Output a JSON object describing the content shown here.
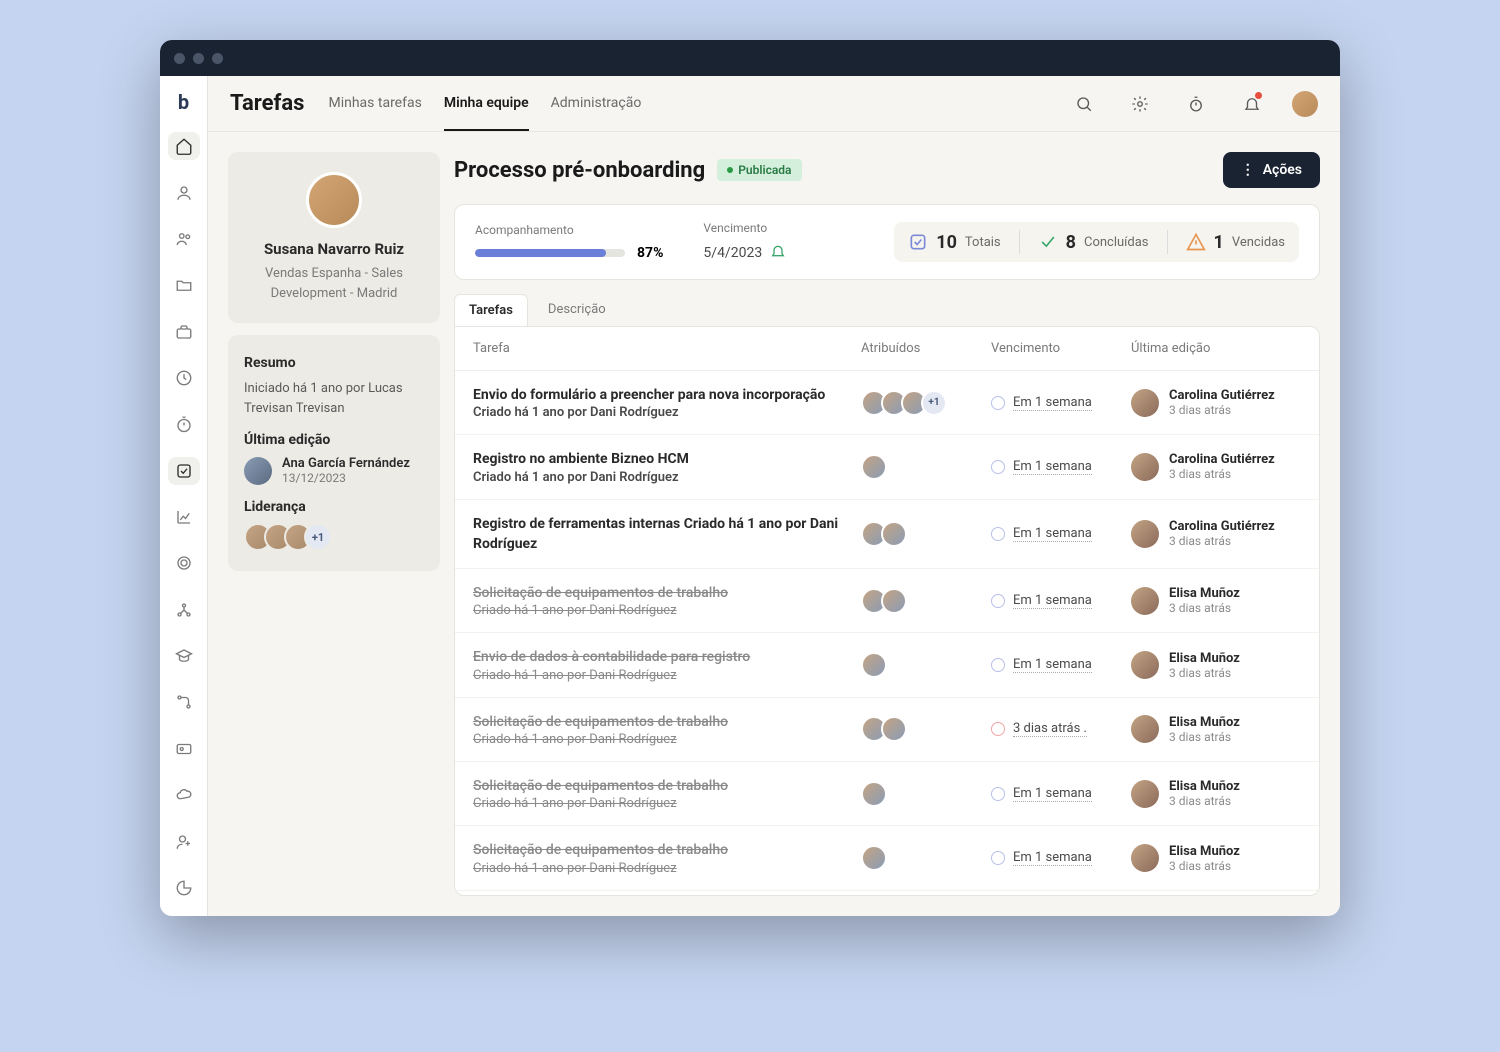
{
  "header": {
    "brand": "Tarefas",
    "tabs": [
      "Minhas tarefas",
      "Minha equipe",
      "Administração"
    ],
    "activeTab": 1
  },
  "profile": {
    "name": "Susana Navarro Ruiz",
    "subtitle": "Vendas Espanha - Sales Development - Madrid"
  },
  "summary": {
    "title": "Resumo",
    "started": "Iniciado há 1 ano por Lucas Trevisan Trevisan",
    "lastEditLabel": "Última edição",
    "editor": {
      "name": "Ana García Fernández",
      "date": "13/12/2023"
    },
    "leadershipLabel": "Liderança",
    "leadershipMore": "+1"
  },
  "page": {
    "title": "Processo pré-onboarding",
    "status": "Publicada",
    "actionsLabel": "Ações"
  },
  "stats": {
    "progressLabel": "Acompanhamento",
    "progressPct": "87%",
    "progressWidth": "87%",
    "dueLabel": "Vencimento",
    "dueValue": "5/4/2023",
    "total": {
      "num": "10",
      "label": "Totais"
    },
    "completed": {
      "num": "8",
      "label": "Concluídas"
    },
    "overdue": {
      "num": "1",
      "label": "Vencidas"
    }
  },
  "contentTabs": [
    "Tarefas",
    "Descrição"
  ],
  "columns": {
    "task": "Tarefa",
    "assigned": "Atribuídos",
    "due": "Vencimento",
    "lastEdit": "Última edição"
  },
  "rows": [
    {
      "title": "Envio do formulário a preencher para nova incorporação",
      "meta": "Criado há 1 ano por Dani Rodríguez",
      "assignees": 3,
      "more": "+1",
      "due": "Em 1 semana",
      "dueRed": false,
      "editor": "Carolina Gutiérrez",
      "edited": "3 dias atrás",
      "done": false
    },
    {
      "title": "Registro no ambiente Bizneo HCM",
      "meta": "Criado há 1 ano por Dani Rodríguez",
      "assignees": 1,
      "more": "",
      "due": "Em 1 semana",
      "dueRed": false,
      "editor": "Carolina Gutiérrez",
      "edited": "3 dias atrás",
      "done": false
    },
    {
      "title": "Registro de ferramentas internas Criado há 1 ano por Dani Rodríguez",
      "meta": "",
      "assignees": 2,
      "more": "",
      "due": "Em 1 semana",
      "dueRed": false,
      "editor": "Carolina Gutiérrez",
      "edited": "3 dias atrás",
      "done": false
    },
    {
      "title": "Solicitação de equipamentos de trabalho",
      "meta": "Criado há 1 ano por Dani Rodríguez",
      "assignees": 2,
      "more": "",
      "due": "Em 1 semana",
      "dueRed": false,
      "editor": "Elisa Muñoz",
      "edited": "3 dias atrás",
      "done": true
    },
    {
      "title": "Envio de dados à contabilidade para registro",
      "meta": "Criado há 1 ano por Dani Rodríguez",
      "assignees": 1,
      "more": "",
      "due": "Em 1 semana",
      "dueRed": false,
      "editor": "Elisa Muñoz",
      "edited": "3 dias atrás",
      "done": true
    },
    {
      "title": "Solicitação de equipamentos de trabalho",
      "meta": "Criado há 1 ano por Dani Rodríguez",
      "assignees": 2,
      "more": "",
      "due": "3 dias atrás .",
      "dueRed": true,
      "editor": "Elisa Muñoz",
      "edited": "3 dias atrás",
      "done": true
    },
    {
      "title": "Solicitação de equipamentos de trabalho",
      "meta": "Criado há 1 ano por Dani Rodríguez",
      "assignees": 1,
      "more": "",
      "due": "Em 1 semana",
      "dueRed": false,
      "editor": "Elisa Muñoz",
      "edited": "3 dias atrás",
      "done": true
    },
    {
      "title": "Solicitação de equipamentos de trabalho",
      "meta": "Criado há 1 ano por Dani Rodríguez",
      "assignees": 1,
      "more": "",
      "due": "Em 1 semana",
      "dueRed": false,
      "editor": "Elisa Muñoz",
      "edited": "3 dias atrás",
      "done": true
    }
  ]
}
